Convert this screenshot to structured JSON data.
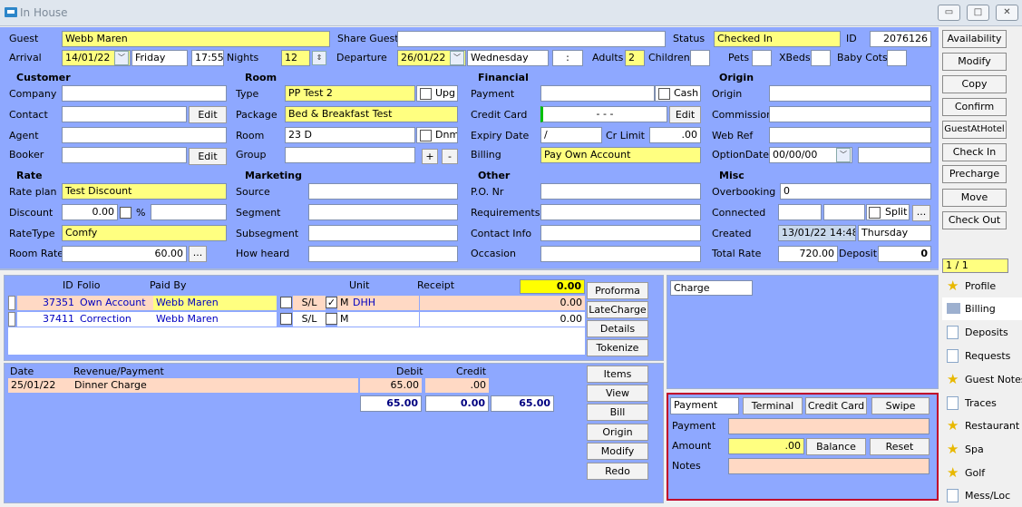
{
  "window": {
    "title": "In House",
    "min": "▭",
    "max": "□",
    "close": "✕"
  },
  "top": {
    "guest_label": "Guest",
    "guest": "Webb Maren",
    "share_label": "Share Guest",
    "share": "",
    "status_label": "Status",
    "status": "Checked In",
    "id_label": "ID",
    "id": "2076126",
    "arrival_label": "Arrival",
    "arrival_date": "14/01/22",
    "arrival_day": "Friday",
    "arrival_time": "17:55",
    "nights_label": "Nights",
    "nights": "12",
    "departure_label": "Departure",
    "departure_date": "26/01/22",
    "departure_day": "Wednesday",
    "departure_time": ":",
    "adults_label": "Adults",
    "adults": "2",
    "children_label": "Children",
    "children": "",
    "pets_label": "Pets",
    "pets": "",
    "xbeds_label": "XBeds",
    "xbeds": "",
    "babycots_label": "Baby Cots",
    "babycots": ""
  },
  "customer": {
    "header": "Customer",
    "company_label": "Company",
    "company": "",
    "contact_label": "Contact",
    "contact": "",
    "agent_label": "Agent",
    "agent": "",
    "booker_label": "Booker",
    "booker": "",
    "edit_label": "Edit"
  },
  "room": {
    "header": "Room",
    "type_label": "Type",
    "type": "PP Test 2",
    "upg_label": "Upg",
    "package_label": "Package",
    "package": "Bed & Breakfast Test",
    "room_label": "Room",
    "room": "23 D",
    "dnm_label": "Dnm",
    "group_label": "Group",
    "group": "",
    "plus": "+",
    "minus": "-"
  },
  "financial": {
    "header": "Financial",
    "payment_label": "Payment",
    "payment": "",
    "cash_label": "Cash",
    "card_label": "Credit Card",
    "card": "-   -   -",
    "edit_label": "Edit",
    "expiry_label": "Expiry Date",
    "expiry": "/",
    "crlimit_label": "Cr Limit",
    "crlimit": ".00",
    "billing_label": "Billing",
    "billing": "Pay Own Account"
  },
  "origin": {
    "header": "Origin",
    "origin_label": "Origin",
    "origin": "",
    "commission_label": "Commission",
    "commission": "",
    "webref_label": "Web Ref",
    "webref": "",
    "optiondate_label": "OptionDate",
    "optiondate": "00/00/00",
    "optiondate2": ""
  },
  "rate": {
    "header": "Rate",
    "plan_label": "Rate plan",
    "plan": "Test Discount",
    "discount_label": "Discount",
    "discount": "0.00",
    "pct": "%",
    "discount_extra": "",
    "type_label": "RateType",
    "type": "Comfy",
    "roomrate_label": "Room Rate",
    "roomrate": "60.00",
    "more": "..."
  },
  "marketing": {
    "header": "Marketing",
    "source_label": "Source",
    "segment_label": "Segment",
    "subsegment_label": "Subsegment",
    "howheard_label": "How heard"
  },
  "other": {
    "header": "Other",
    "po_label": "P.O. Nr",
    "req_label": "Requirements",
    "contact_label": "Contact Info",
    "occasion_label": "Occasion"
  },
  "misc": {
    "header": "Misc",
    "overbooking_label": "Overbooking",
    "overbooking": "0",
    "connected_label": "Connected",
    "split_label": "Split",
    "more": "...",
    "created_label": "Created",
    "created": "13/01/22 14:48",
    "created_day": "Thursday",
    "totalrate_label": "Total Rate",
    "totalrate": "720.00",
    "deposit_label": "Deposit",
    "deposit": "0"
  },
  "actions": [
    "Availability",
    "Modify",
    "Copy",
    "Confirm",
    "GuestAtHotel",
    "Check In",
    "Precharge",
    "Move",
    "Check Out"
  ],
  "pager": "1 / 1",
  "folio": {
    "headers": {
      "id": "ID",
      "folio": "Folio",
      "paidby": "Paid By",
      "unit": "Unit",
      "receipt": "Receipt"
    },
    "receipt_total": "0.00",
    "rows": [
      {
        "id": "37351",
        "folio": "Own Account",
        "paidby": "Webb Maren",
        "sl": "S/L",
        "m": "M",
        "unit": "DHH",
        "amount": "0.00"
      },
      {
        "id": "37411",
        "folio": "Correction",
        "paidby": "Webb Maren",
        "sl": "S/L",
        "m": "M",
        "unit": "",
        "amount": "0.00"
      }
    ],
    "total": "0.00",
    "buttons": [
      "Proforma",
      "LateCharge",
      "Details",
      "Tokenize"
    ]
  },
  "ledger": {
    "headers": {
      "date": "Date",
      "desc": "Revenue/Payment",
      "debit": "Debit",
      "credit": "Credit"
    },
    "rows": [
      {
        "date": "25/01/22",
        "desc": "Dinner Charge",
        "debit": "65.00",
        "credit": ".00"
      }
    ],
    "total_debit": "65.00",
    "total_credit": "0.00",
    "balance": "65.00",
    "buttons": [
      "Items",
      "View",
      "Bill",
      "Origin",
      "Modify",
      "Redo"
    ]
  },
  "charge": {
    "label": "Charge"
  },
  "payment": {
    "tab": "Payment",
    "terminal": "Terminal",
    "credit_card": "Credit Card",
    "swipe": "Swipe",
    "payment_label": "Payment",
    "amount_label": "Amount",
    "amount": ".00",
    "balance": "Balance",
    "reset": "Reset",
    "notes_label": "Notes"
  },
  "tabs": [
    "Profile",
    "Billing",
    "Deposits",
    "Requests",
    "Guest Notes",
    "Traces",
    "Restaurant",
    "Spa",
    "Golf",
    "Mess/Loc"
  ],
  "colors": {
    "panel": "#8ea8ff",
    "field_yellow": "#ffff80",
    "row_pink": "#ffd9c4",
    "total_yellow": "#ffff00",
    "accent_red": "#c0002a"
  }
}
